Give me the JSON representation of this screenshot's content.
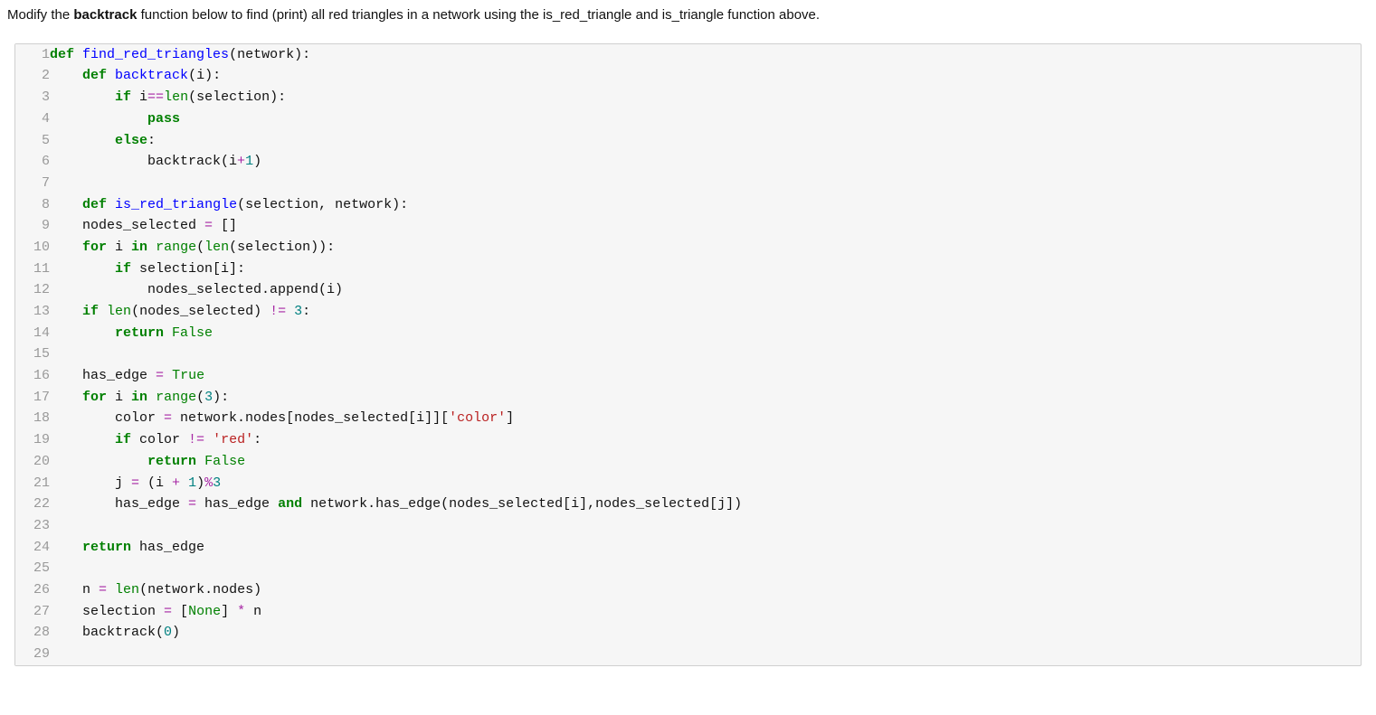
{
  "instruction": {
    "pre": "Modify the ",
    "bold": "backtrack",
    "post": " function below to find (print) all red triangles in a network using the is_red_triangle and is_triangle function above."
  },
  "code": {
    "lines": [
      {
        "n": "1",
        "tokens": [
          [
            "kw",
            "def"
          ],
          [
            "",
            " "
          ],
          [
            "def",
            "find_red_triangles"
          ],
          [
            "",
            "(network):"
          ]
        ]
      },
      {
        "n": "2",
        "tokens": [
          [
            "",
            "    "
          ],
          [
            "kw",
            "def"
          ],
          [
            "",
            " "
          ],
          [
            "def",
            "backtrack"
          ],
          [
            "",
            "(i):"
          ]
        ]
      },
      {
        "n": "3",
        "tokens": [
          [
            "",
            "        "
          ],
          [
            "kw",
            "if"
          ],
          [
            "",
            " i"
          ],
          [
            "op",
            "=="
          ],
          [
            "bi",
            "len"
          ],
          [
            "",
            "(selection):"
          ]
        ]
      },
      {
        "n": "4",
        "tokens": [
          [
            "",
            "            "
          ],
          [
            "kw",
            "pass"
          ]
        ]
      },
      {
        "n": "5",
        "tokens": [
          [
            "",
            "        "
          ],
          [
            "kw",
            "else"
          ],
          [
            "",
            ":"
          ]
        ]
      },
      {
        "n": "6",
        "tokens": [
          [
            "",
            "            backtrack(i"
          ],
          [
            "op",
            "+"
          ],
          [
            "num",
            "1"
          ],
          [
            "",
            ")"
          ]
        ]
      },
      {
        "n": "7",
        "tokens": [
          [
            "",
            ""
          ]
        ]
      },
      {
        "n": "8",
        "tokens": [
          [
            "",
            "    "
          ],
          [
            "kw",
            "def"
          ],
          [
            "",
            " "
          ],
          [
            "def",
            "is_red_triangle"
          ],
          [
            "",
            "(selection, network):"
          ]
        ]
      },
      {
        "n": "9",
        "tokens": [
          [
            "",
            "    nodes_selected "
          ],
          [
            "op",
            "="
          ],
          [
            "",
            " []"
          ]
        ]
      },
      {
        "n": "10",
        "tokens": [
          [
            "",
            "    "
          ],
          [
            "kw",
            "for"
          ],
          [
            "",
            " i "
          ],
          [
            "kw",
            "in"
          ],
          [
            "",
            " "
          ],
          [
            "bi",
            "range"
          ],
          [
            "",
            "("
          ],
          [
            "bi",
            "len"
          ],
          [
            "",
            "(selection)):"
          ]
        ]
      },
      {
        "n": "11",
        "tokens": [
          [
            "",
            "        "
          ],
          [
            "kw",
            "if"
          ],
          [
            "",
            " selection[i]:"
          ]
        ]
      },
      {
        "n": "12",
        "tokens": [
          [
            "",
            "            nodes_selected.append(i)"
          ]
        ]
      },
      {
        "n": "13",
        "tokens": [
          [
            "",
            "    "
          ],
          [
            "kw",
            "if"
          ],
          [
            "",
            " "
          ],
          [
            "bi",
            "len"
          ],
          [
            "",
            "(nodes_selected) "
          ],
          [
            "op",
            "!="
          ],
          [
            "",
            " "
          ],
          [
            "num",
            "3"
          ],
          [
            "",
            ":"
          ]
        ]
      },
      {
        "n": "14",
        "tokens": [
          [
            "",
            "        "
          ],
          [
            "kw",
            "return"
          ],
          [
            "",
            " "
          ],
          [
            "bi",
            "False"
          ]
        ]
      },
      {
        "n": "15",
        "tokens": [
          [
            "",
            ""
          ]
        ]
      },
      {
        "n": "16",
        "tokens": [
          [
            "",
            "    has_edge "
          ],
          [
            "op",
            "="
          ],
          [
            "",
            " "
          ],
          [
            "bi",
            "True"
          ]
        ]
      },
      {
        "n": "17",
        "tokens": [
          [
            "",
            "    "
          ],
          [
            "kw",
            "for"
          ],
          [
            "",
            " i "
          ],
          [
            "kw",
            "in"
          ],
          [
            "",
            " "
          ],
          [
            "bi",
            "range"
          ],
          [
            "",
            "("
          ],
          [
            "num",
            "3"
          ],
          [
            "",
            "):"
          ]
        ]
      },
      {
        "n": "18",
        "tokens": [
          [
            "",
            "        color "
          ],
          [
            "op",
            "="
          ],
          [
            "",
            " network.nodes[nodes_selected[i]]["
          ],
          [
            "str",
            "'color'"
          ],
          [
            "",
            "]"
          ]
        ]
      },
      {
        "n": "19",
        "tokens": [
          [
            "",
            "        "
          ],
          [
            "kw",
            "if"
          ],
          [
            "",
            " color "
          ],
          [
            "op",
            "!="
          ],
          [
            "",
            " "
          ],
          [
            "str",
            "'red'"
          ],
          [
            "",
            ":"
          ]
        ]
      },
      {
        "n": "20",
        "tokens": [
          [
            "",
            "            "
          ],
          [
            "kw",
            "return"
          ],
          [
            "",
            " "
          ],
          [
            "bi",
            "False"
          ]
        ]
      },
      {
        "n": "21",
        "tokens": [
          [
            "",
            "        j "
          ],
          [
            "op",
            "="
          ],
          [
            "",
            " (i "
          ],
          [
            "op",
            "+"
          ],
          [
            "",
            " "
          ],
          [
            "num",
            "1"
          ],
          [
            "",
            ")"
          ],
          [
            "op",
            "%"
          ],
          [
            "num",
            "3"
          ]
        ]
      },
      {
        "n": "22",
        "tokens": [
          [
            "",
            "        has_edge "
          ],
          [
            "op",
            "="
          ],
          [
            "",
            " has_edge "
          ],
          [
            "kw",
            "and"
          ],
          [
            "",
            " network.has_edge(nodes_selected[i],nodes_selected[j])"
          ]
        ]
      },
      {
        "n": "23",
        "tokens": [
          [
            "",
            ""
          ]
        ]
      },
      {
        "n": "24",
        "tokens": [
          [
            "",
            "    "
          ],
          [
            "kw",
            "return"
          ],
          [
            "",
            " has_edge"
          ]
        ]
      },
      {
        "n": "25",
        "tokens": [
          [
            "",
            ""
          ]
        ]
      },
      {
        "n": "26",
        "tokens": [
          [
            "",
            "    n "
          ],
          [
            "op",
            "="
          ],
          [
            "",
            " "
          ],
          [
            "bi",
            "len"
          ],
          [
            "",
            "(network.nodes)"
          ]
        ]
      },
      {
        "n": "27",
        "tokens": [
          [
            "",
            "    selection "
          ],
          [
            "op",
            "="
          ],
          [
            "",
            " ["
          ],
          [
            "bi",
            "None"
          ],
          [
            "",
            "] "
          ],
          [
            "op",
            "*"
          ],
          [
            "",
            " n"
          ]
        ]
      },
      {
        "n": "28",
        "tokens": [
          [
            "",
            "    backtrack("
          ],
          [
            "num",
            "0"
          ],
          [
            "",
            ")"
          ]
        ]
      },
      {
        "n": "29",
        "tokens": [
          [
            "",
            ""
          ]
        ]
      }
    ]
  }
}
